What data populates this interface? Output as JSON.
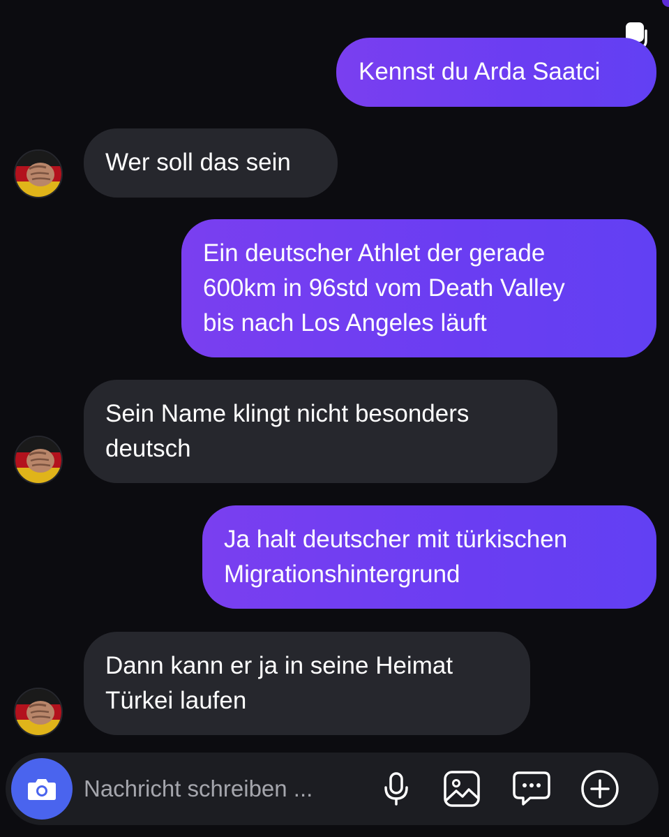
{
  "conversation": {
    "messages": [
      {
        "direction": "out",
        "text": "Kennst du Arda Saatci"
      },
      {
        "direction": "in",
        "text": "Wer soll das sein"
      },
      {
        "direction": "out",
        "text": "Ein deutscher Athlet der gerade\n600km in 96std vom Death Valley\nbis nach Los Angeles läuft"
      },
      {
        "direction": "in",
        "text": "Sein Name klingt nicht besonders\ndeutsch"
      },
      {
        "direction": "out",
        "text": "Ja halt deutscher mit türkischen\nMigrationshintergrund"
      },
      {
        "direction": "in",
        "text": "Dann kann er ja in seine Heimat\nTürkei laufen"
      }
    ]
  },
  "composer": {
    "placeholder": "Nachricht schreiben ...",
    "value": "",
    "icons": [
      "camera-icon",
      "microphone-icon",
      "gallery-icon",
      "sticker-icon",
      "plus-icon"
    ]
  },
  "colors": {
    "background": "#0c0c10",
    "outgoing_bubble": "#6a3df2",
    "incoming_bubble": "#26272d",
    "camera_button": "#4a64ee",
    "text": "#ffffff",
    "placeholder": "#a5a6ad"
  }
}
